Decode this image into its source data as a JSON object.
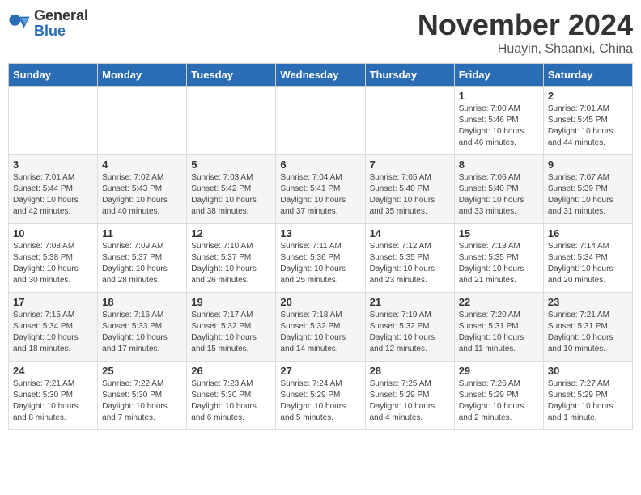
{
  "logo": {
    "general": "General",
    "blue": "Blue"
  },
  "header": {
    "month": "November 2024",
    "location": "Huayin, Shaanxi, China"
  },
  "weekdays": [
    "Sunday",
    "Monday",
    "Tuesday",
    "Wednesday",
    "Thursday",
    "Friday",
    "Saturday"
  ],
  "weeks": [
    [
      {
        "day": "",
        "info": ""
      },
      {
        "day": "",
        "info": ""
      },
      {
        "day": "",
        "info": ""
      },
      {
        "day": "",
        "info": ""
      },
      {
        "day": "",
        "info": ""
      },
      {
        "day": "1",
        "info": "Sunrise: 7:00 AM\nSunset: 5:46 PM\nDaylight: 10 hours\nand 46 minutes."
      },
      {
        "day": "2",
        "info": "Sunrise: 7:01 AM\nSunset: 5:45 PM\nDaylight: 10 hours\nand 44 minutes."
      }
    ],
    [
      {
        "day": "3",
        "info": "Sunrise: 7:01 AM\nSunset: 5:44 PM\nDaylight: 10 hours\nand 42 minutes."
      },
      {
        "day": "4",
        "info": "Sunrise: 7:02 AM\nSunset: 5:43 PM\nDaylight: 10 hours\nand 40 minutes."
      },
      {
        "day": "5",
        "info": "Sunrise: 7:03 AM\nSunset: 5:42 PM\nDaylight: 10 hours\nand 38 minutes."
      },
      {
        "day": "6",
        "info": "Sunrise: 7:04 AM\nSunset: 5:41 PM\nDaylight: 10 hours\nand 37 minutes."
      },
      {
        "day": "7",
        "info": "Sunrise: 7:05 AM\nSunset: 5:40 PM\nDaylight: 10 hours\nand 35 minutes."
      },
      {
        "day": "8",
        "info": "Sunrise: 7:06 AM\nSunset: 5:40 PM\nDaylight: 10 hours\nand 33 minutes."
      },
      {
        "day": "9",
        "info": "Sunrise: 7:07 AM\nSunset: 5:39 PM\nDaylight: 10 hours\nand 31 minutes."
      }
    ],
    [
      {
        "day": "10",
        "info": "Sunrise: 7:08 AM\nSunset: 5:38 PM\nDaylight: 10 hours\nand 30 minutes."
      },
      {
        "day": "11",
        "info": "Sunrise: 7:09 AM\nSunset: 5:37 PM\nDaylight: 10 hours\nand 28 minutes."
      },
      {
        "day": "12",
        "info": "Sunrise: 7:10 AM\nSunset: 5:37 PM\nDaylight: 10 hours\nand 26 minutes."
      },
      {
        "day": "13",
        "info": "Sunrise: 7:11 AM\nSunset: 5:36 PM\nDaylight: 10 hours\nand 25 minutes."
      },
      {
        "day": "14",
        "info": "Sunrise: 7:12 AM\nSunset: 5:35 PM\nDaylight: 10 hours\nand 23 minutes."
      },
      {
        "day": "15",
        "info": "Sunrise: 7:13 AM\nSunset: 5:35 PM\nDaylight: 10 hours\nand 21 minutes."
      },
      {
        "day": "16",
        "info": "Sunrise: 7:14 AM\nSunset: 5:34 PM\nDaylight: 10 hours\nand 20 minutes."
      }
    ],
    [
      {
        "day": "17",
        "info": "Sunrise: 7:15 AM\nSunset: 5:34 PM\nDaylight: 10 hours\nand 18 minutes."
      },
      {
        "day": "18",
        "info": "Sunrise: 7:16 AM\nSunset: 5:33 PM\nDaylight: 10 hours\nand 17 minutes."
      },
      {
        "day": "19",
        "info": "Sunrise: 7:17 AM\nSunset: 5:32 PM\nDaylight: 10 hours\nand 15 minutes."
      },
      {
        "day": "20",
        "info": "Sunrise: 7:18 AM\nSunset: 5:32 PM\nDaylight: 10 hours\nand 14 minutes."
      },
      {
        "day": "21",
        "info": "Sunrise: 7:19 AM\nSunset: 5:32 PM\nDaylight: 10 hours\nand 12 minutes."
      },
      {
        "day": "22",
        "info": "Sunrise: 7:20 AM\nSunset: 5:31 PM\nDaylight: 10 hours\nand 11 minutes."
      },
      {
        "day": "23",
        "info": "Sunrise: 7:21 AM\nSunset: 5:31 PM\nDaylight: 10 hours\nand 10 minutes."
      }
    ],
    [
      {
        "day": "24",
        "info": "Sunrise: 7:21 AM\nSunset: 5:30 PM\nDaylight: 10 hours\nand 8 minutes."
      },
      {
        "day": "25",
        "info": "Sunrise: 7:22 AM\nSunset: 5:30 PM\nDaylight: 10 hours\nand 7 minutes."
      },
      {
        "day": "26",
        "info": "Sunrise: 7:23 AM\nSunset: 5:30 PM\nDaylight: 10 hours\nand 6 minutes."
      },
      {
        "day": "27",
        "info": "Sunrise: 7:24 AM\nSunset: 5:29 PM\nDaylight: 10 hours\nand 5 minutes."
      },
      {
        "day": "28",
        "info": "Sunrise: 7:25 AM\nSunset: 5:29 PM\nDaylight: 10 hours\nand 4 minutes."
      },
      {
        "day": "29",
        "info": "Sunrise: 7:26 AM\nSunset: 5:29 PM\nDaylight: 10 hours\nand 2 minutes."
      },
      {
        "day": "30",
        "info": "Sunrise: 7:27 AM\nSunset: 5:29 PM\nDaylight: 10 hours\nand 1 minute."
      }
    ]
  ]
}
